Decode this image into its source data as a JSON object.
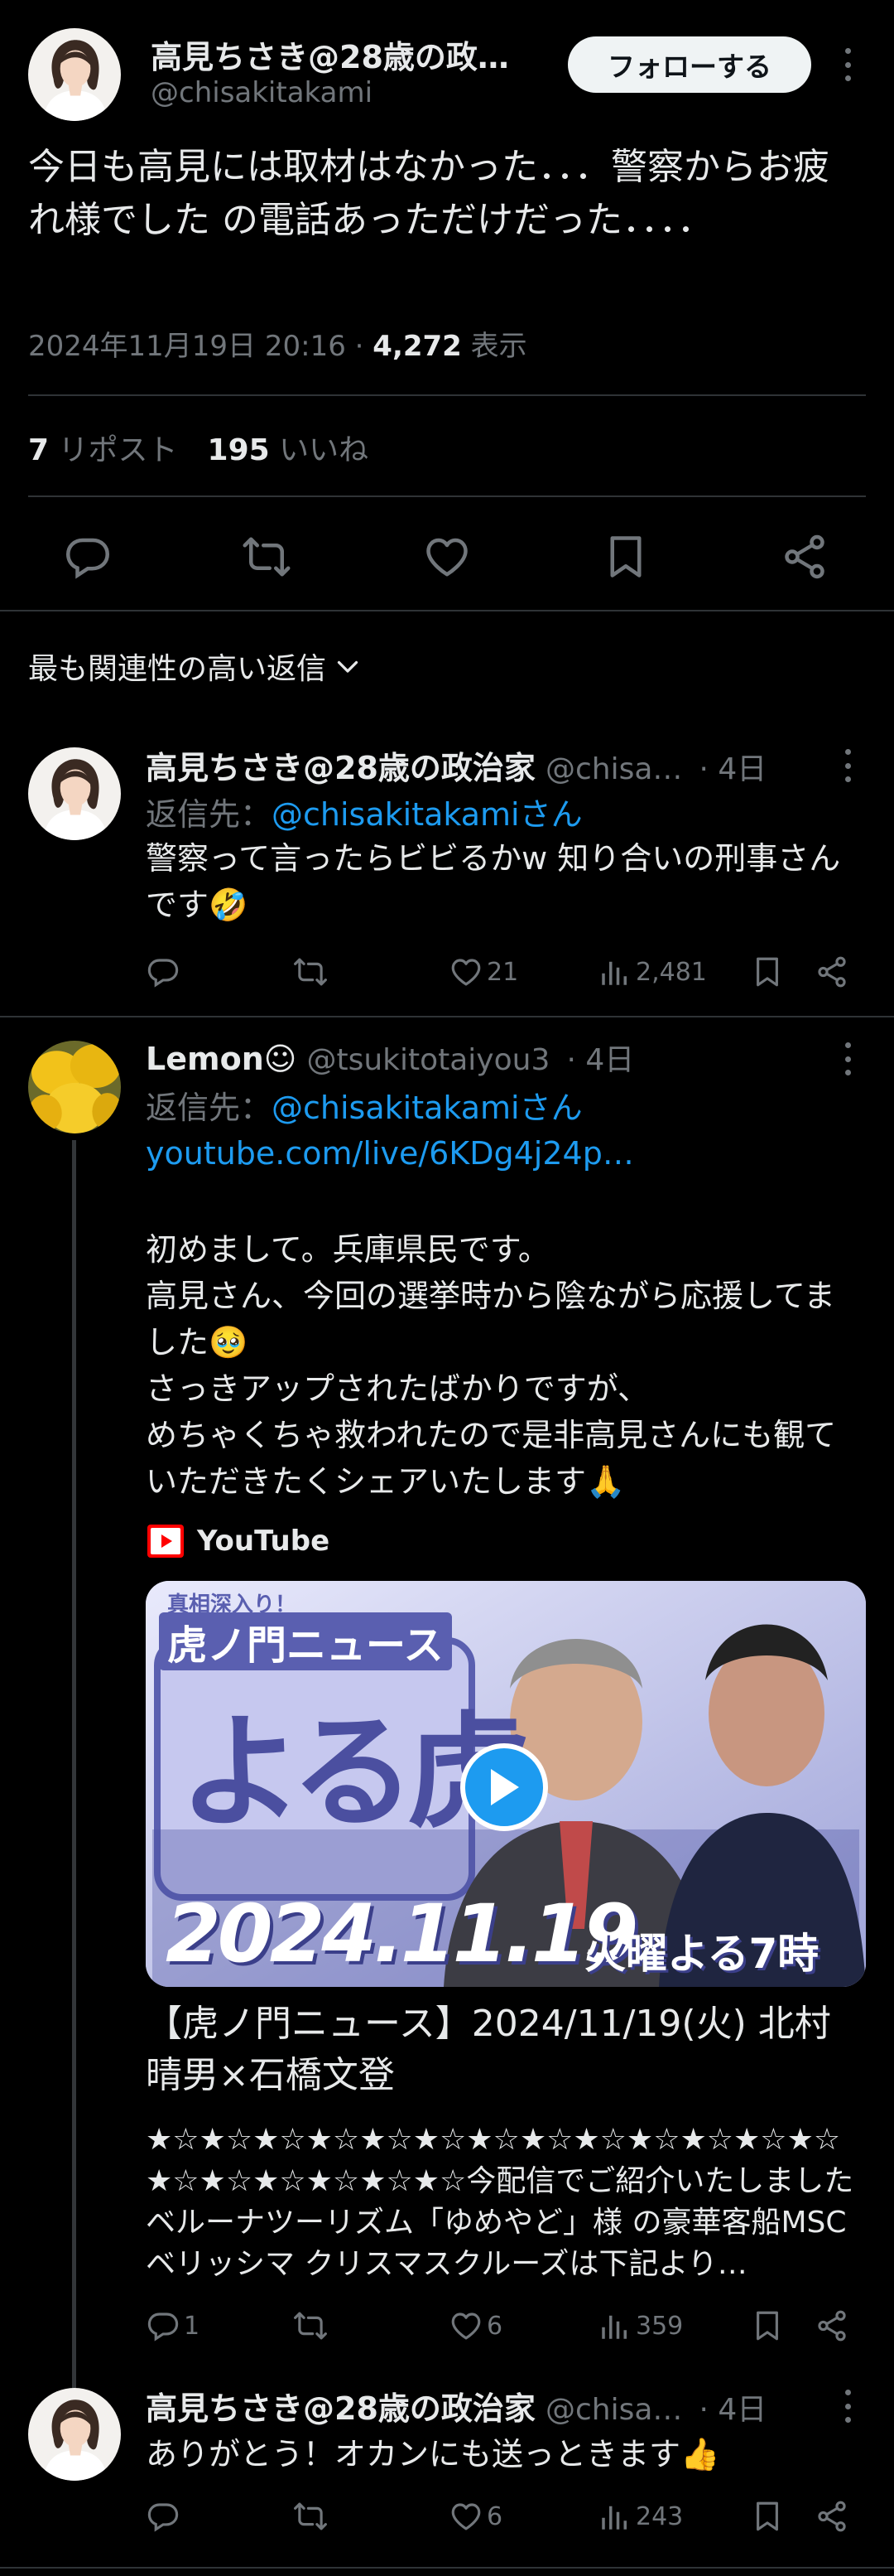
{
  "main_tweet": {
    "author_name": "高見ちさき@28歳の政…",
    "handle": "@chisakitakami",
    "follow_label": "フォローする",
    "text": "今日も高見には取材はなかった．．．警察からお疲れ様でした の電話あっただけだった．．．．",
    "date": "2024年11月19日 20:16 · ",
    "views_count": "4,272",
    "views_label": " 表示",
    "reposts_count": "7",
    "reposts_label": " リポスト",
    "likes_count": "195",
    "likes_label": " いいね"
  },
  "replies_filter": {
    "label": "最も関連性の高い返信"
  },
  "replies": [
    {
      "author_name": "高見ちさき@28歳の政治家",
      "handle": "@chisa…",
      "time": "· 4日",
      "reply_to_prefix": "返信先：",
      "reply_to_handle": "@chisakitakamiさん",
      "text": "警察って言ったらビビるかw 知り合いの刑事さんです🤣",
      "stats": {
        "replies": "",
        "reposts": "",
        "likes": "21",
        "views": "2,481"
      }
    },
    {
      "author_name": "Lemon☺",
      "handle": "@tsukitotaiyou3",
      "time": "· 4日",
      "reply_to_prefix": "返信先：",
      "reply_to_handle": "@chisakitakamiさん",
      "link_text": "youtube.com/live/6KDg4j24p…",
      "text": "初めまして。兵庫県民です。\n高見さん、今回の選挙時から陰ながら応援してました🥹\nさっきアップされたばかりですが、\nめちゃくちゃ救われたので是非高見さんにも観ていただきたくシェアいたします🙏",
      "card": {
        "source": "YouTube",
        "thumb_tag": "真相深入り！",
        "thumb_title": "虎ノ門ニュース",
        "thumb_big": "よる虎",
        "thumb_date": "2024.11.19",
        "thumb_day": "火曜よる7時",
        "title": "【虎ノ門ニュース】2024/11/19(火) 北村晴男×石橋文登",
        "desc": "★☆★☆★☆★☆★☆★☆★☆★☆★☆★☆★☆★☆★☆★☆★☆★☆★☆★☆★☆今配信でご紹介いたしましたベルーナツーリズム「ゆめやど」様 の豪華客船MSCベリッシマ クリスマスクルーズは下記より…"
      },
      "stats": {
        "replies": "1",
        "reposts": "",
        "likes": "6",
        "views": "359"
      }
    },
    {
      "author_name": "高見ちさき@28歳の政治家",
      "handle": "@chisa…",
      "time": "· 4日",
      "text": "ありがとう！オカンにも送っときます👍",
      "stats": {
        "replies": "",
        "reposts": "",
        "likes": "6",
        "views": "243"
      }
    }
  ],
  "colors": {
    "background": "#000000",
    "text": "#e7e9ea",
    "muted": "#71767b",
    "link": "#1d9bf0",
    "divider": "#2f3336",
    "youtube_red": "#ff0000"
  }
}
